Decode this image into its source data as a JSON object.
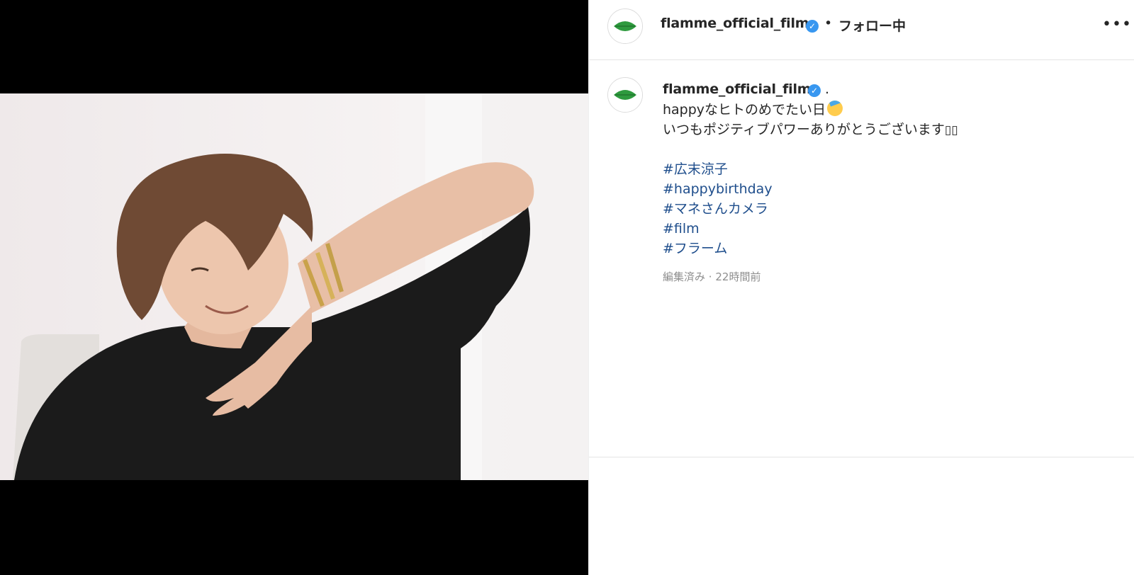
{
  "post": {
    "username": "flamme_official_film",
    "verified_badge_icon": "verified-check-icon",
    "follow_status": "フォロー中",
    "more_options_icon": "more-horizontal-icon"
  },
  "caption": {
    "username": "flamme_official_film",
    "lead_period": ".",
    "line1": "happyなヒトのめでたい日",
    "line1_emoji_icon": "party-face-emoji",
    "line2": "いつもポジティブパワーありがとうございます",
    "line2_trailing": "▯▯",
    "hashtags": [
      "#広末涼子",
      "#happybirthday",
      "#マネさんカメラ",
      "#film",
      "#フラーム"
    ]
  },
  "meta": {
    "edited": "編集済み",
    "separator": "·",
    "timestamp": "22時間前"
  },
  "colors": {
    "link": "#1f4e8c",
    "verified": "#3897f0",
    "avatar_leaf": "#2e9a3e"
  }
}
